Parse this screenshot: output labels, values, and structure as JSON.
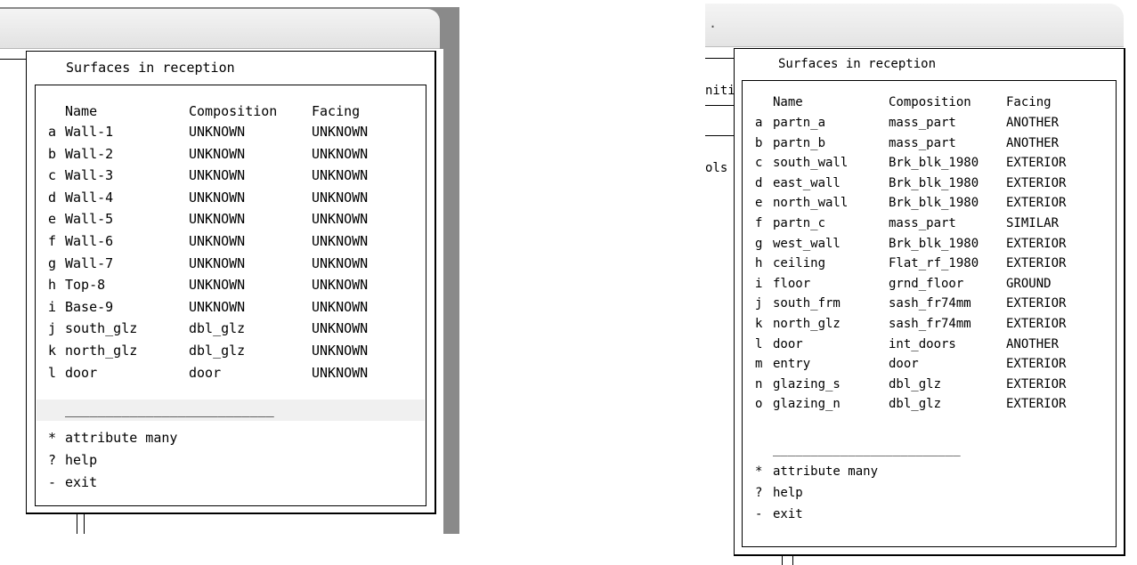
{
  "left": {
    "title": "Surfaces in reception",
    "headers": {
      "name": "Name",
      "composition": "Composition",
      "facing": "Facing"
    },
    "rows": [
      {
        "key": "a",
        "name": "Wall-1",
        "composition": "UNKNOWN",
        "facing": "UNKNOWN"
      },
      {
        "key": "b",
        "name": "Wall-2",
        "composition": "UNKNOWN",
        "facing": "UNKNOWN"
      },
      {
        "key": "c",
        "name": "Wall-3",
        "composition": "UNKNOWN",
        "facing": "UNKNOWN"
      },
      {
        "key": "d",
        "name": "Wall-4",
        "composition": "UNKNOWN",
        "facing": "UNKNOWN"
      },
      {
        "key": "e",
        "name": "Wall-5",
        "composition": "UNKNOWN",
        "facing": "UNKNOWN"
      },
      {
        "key": "f",
        "name": "Wall-6",
        "composition": "UNKNOWN",
        "facing": "UNKNOWN"
      },
      {
        "key": "g",
        "name": "Wall-7",
        "composition": "UNKNOWN",
        "facing": "UNKNOWN"
      },
      {
        "key": "h",
        "name": "Top-8",
        "composition": "UNKNOWN",
        "facing": "UNKNOWN"
      },
      {
        "key": "i",
        "name": "Base-9",
        "composition": "UNKNOWN",
        "facing": "UNKNOWN"
      },
      {
        "key": "j",
        "name": "south_glz",
        "composition": "dbl_glz",
        "facing": "UNKNOWN"
      },
      {
        "key": "k",
        "name": "north_glz",
        "composition": "dbl_glz",
        "facing": "UNKNOWN"
      },
      {
        "key": "l",
        "name": "door",
        "composition": "door",
        "facing": "UNKNOWN"
      }
    ],
    "separator": "__________________________",
    "options": [
      {
        "key": "*",
        "label": "attribute many"
      },
      {
        "key": "?",
        "label": "help"
      },
      {
        "key": "-",
        "label": "exit"
      }
    ]
  },
  "right": {
    "title": "Surfaces in reception",
    "background_fragments": [
      "niti",
      "ols",
      "."
    ],
    "headers": {
      "name": "Name",
      "composition": "Composition",
      "facing": "Facing"
    },
    "rows": [
      {
        "key": "a",
        "name": "partn_a",
        "composition": "mass_part",
        "facing": "ANOTHER"
      },
      {
        "key": "b",
        "name": "partn_b",
        "composition": "mass_part",
        "facing": "ANOTHER"
      },
      {
        "key": "c",
        "name": "south_wall",
        "composition": "Brk_blk_1980",
        "facing": "EXTERIOR"
      },
      {
        "key": "d",
        "name": "east_wall",
        "composition": "Brk_blk_1980",
        "facing": "EXTERIOR"
      },
      {
        "key": "e",
        "name": "north_wall",
        "composition": "Brk_blk_1980",
        "facing": "EXTERIOR"
      },
      {
        "key": "f",
        "name": "partn_c",
        "composition": "mass_part",
        "facing": "SIMILAR"
      },
      {
        "key": "g",
        "name": "west_wall",
        "composition": "Brk_blk_1980",
        "facing": "EXTERIOR"
      },
      {
        "key": "h",
        "name": "ceiling",
        "composition": "Flat_rf_1980",
        "facing": "EXTERIOR"
      },
      {
        "key": "i",
        "name": "floor",
        "composition": "grnd_floor",
        "facing": "GROUND"
      },
      {
        "key": "j",
        "name": "south_frm",
        "composition": "sash_fr74mm",
        "facing": "EXTERIOR"
      },
      {
        "key": "k",
        "name": "north_glz",
        "composition": "sash_fr74mm",
        "facing": "EXTERIOR"
      },
      {
        "key": "l",
        "name": "door",
        "composition": "int_doors",
        "facing": "ANOTHER"
      },
      {
        "key": "m",
        "name": "entry",
        "composition": "door",
        "facing": "EXTERIOR"
      },
      {
        "key": "n",
        "name": "glazing_s",
        "composition": "dbl_glz",
        "facing": "EXTERIOR"
      },
      {
        "key": "o",
        "name": "glazing_n",
        "composition": "dbl_glz",
        "facing": "EXTERIOR"
      }
    ],
    "separator": "_________________________",
    "options": [
      {
        "key": "*",
        "label": "attribute many"
      },
      {
        "key": "?",
        "label": "help"
      },
      {
        "key": "-",
        "label": "exit"
      }
    ]
  }
}
